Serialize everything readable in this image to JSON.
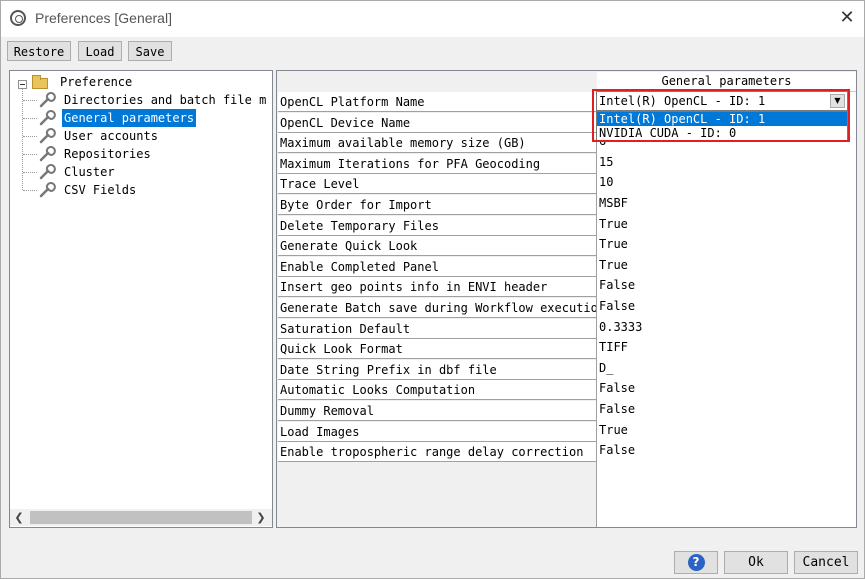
{
  "window": {
    "title": "Preferences [General]",
    "close_label": "✕"
  },
  "toolbar": {
    "restore_label": "Restore",
    "load_label": "Load",
    "save_label": "Save"
  },
  "tree": {
    "root": "Preference",
    "items": [
      "Directories and batch file m",
      "General parameters",
      "User accounts",
      "Repositories",
      "Cluster",
      "CSV Fields"
    ],
    "selected": "General parameters"
  },
  "grid": {
    "header": "General parameters",
    "rows": [
      {
        "name": "OpenCL Platform Name",
        "value": "Intel(R) OpenCL - ID: 1"
      },
      {
        "name": "OpenCL Device Name",
        "value": ""
      },
      {
        "name": "Maximum available memory size (GB)",
        "value": "6"
      },
      {
        "name": "Maximum Iterations for PFA Geocoding",
        "value": "15"
      },
      {
        "name": "Trace Level",
        "value": "10"
      },
      {
        "name": "Byte Order for Import",
        "value": "MSBF"
      },
      {
        "name": "Delete Temporary Files",
        "value": "True"
      },
      {
        "name": "Generate Quick Look",
        "value": "True"
      },
      {
        "name": "Enable Completed Panel",
        "value": "True"
      },
      {
        "name": "Insert geo points info in ENVI header",
        "value": "False"
      },
      {
        "name": "Generate Batch save during Workflow execution",
        "value": "False"
      },
      {
        "name": "Saturation Default",
        "value": "0.3333"
      },
      {
        "name": "Quick Look Format",
        "value": "TIFF"
      },
      {
        "name": "Date String Prefix in dbf file",
        "value": "D_"
      },
      {
        "name": "Automatic Looks Computation",
        "value": "False"
      },
      {
        "name": "Dummy Removal",
        "value": "False"
      },
      {
        "name": "Load Images",
        "value": "True"
      },
      {
        "name": "Enable tropospheric range delay correction",
        "value": "False"
      }
    ]
  },
  "combo": {
    "selected": "Intel(R) OpenCL - ID: 1",
    "options": [
      "Intel(R) OpenCL - ID: 1",
      "NVIDIA CUDA - ID: 0"
    ],
    "highlighted_option": "Intel(R) OpenCL - ID: 1"
  },
  "buttons": {
    "help_label": "?",
    "ok_label": "Ok",
    "cancel_label": "Cancel"
  },
  "colors": {
    "selection": "#0078d7",
    "callout": "#e02020",
    "help": "#2a62c8"
  }
}
